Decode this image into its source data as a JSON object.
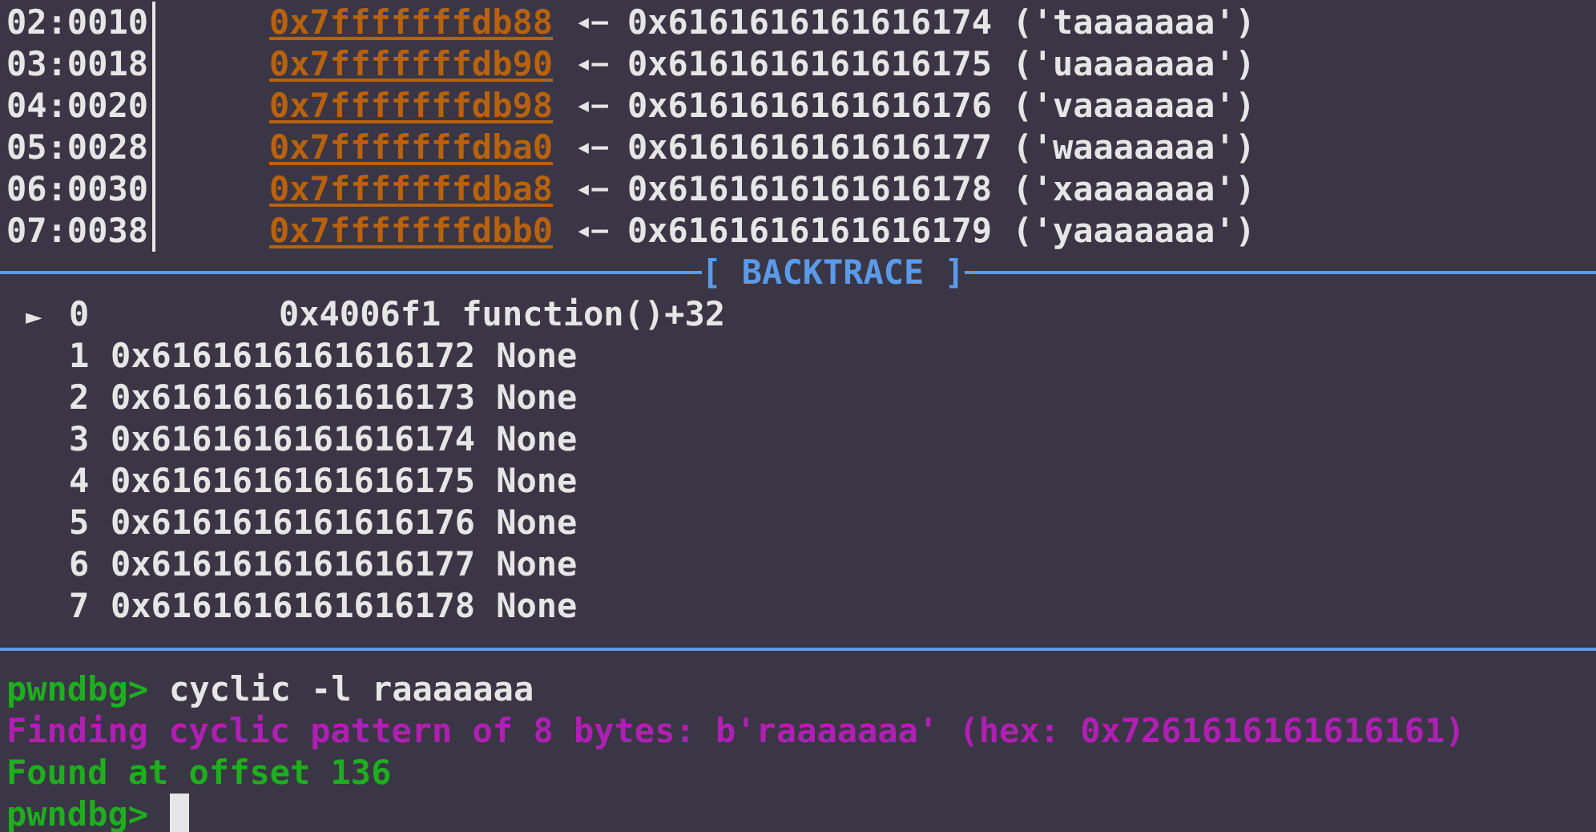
{
  "stack": [
    {
      "offset": "02:0010",
      "address": "0x7fffffffdb88",
      "arrow": "◂—",
      "value": "0x6161616161616174 ('taaaaaaa')"
    },
    {
      "offset": "03:0018",
      "address": "0x7fffffffdb90",
      "arrow": "◂—",
      "value": "0x6161616161616175 ('uaaaaaaa')"
    },
    {
      "offset": "04:0020",
      "address": "0x7fffffffdb98",
      "arrow": "◂—",
      "value": "0x6161616161616176 ('vaaaaaaa')"
    },
    {
      "offset": "05:0028",
      "address": "0x7fffffffdba0",
      "arrow": "◂—",
      "value": "0x6161616161616177 ('waaaaaaa')"
    },
    {
      "offset": "06:0030",
      "address": "0x7fffffffdba8",
      "arrow": "◂—",
      "value": "0x6161616161616178 ('xaaaaaaa')"
    },
    {
      "offset": "07:0038",
      "address": "0x7fffffffdbb0",
      "arrow": "◂—",
      "value": "0x6161616161616179 ('yaaaaaaa')"
    }
  ],
  "backtrace": {
    "title": "[ BACKTRACE ]",
    "marker": "►",
    "frames": [
      {
        "index": "0",
        "address": "0x4006f1",
        "symbol": "function()+32",
        "selected": true
      },
      {
        "index": "1",
        "address": "0x6161616161616172",
        "symbol": "None",
        "selected": false
      },
      {
        "index": "2",
        "address": "0x6161616161616173",
        "symbol": "None",
        "selected": false
      },
      {
        "index": "3",
        "address": "0x6161616161616174",
        "symbol": "None",
        "selected": false
      },
      {
        "index": "4",
        "address": "0x6161616161616175",
        "symbol": "None",
        "selected": false
      },
      {
        "index": "5",
        "address": "0x6161616161616176",
        "symbol": "None",
        "selected": false
      },
      {
        "index": "6",
        "address": "0x6161616161616177",
        "symbol": "None",
        "selected": false
      },
      {
        "index": "7",
        "address": "0x6161616161616178",
        "symbol": "None",
        "selected": false
      }
    ]
  },
  "console": [
    {
      "kind": "command",
      "prompt": "pwndbg>",
      "text": "cyclic -l raaaaaaa"
    },
    {
      "kind": "info",
      "text": "Finding cyclic pattern of 8 bytes: b'raaaaaaa' (hex: 0x7261616161616161)"
    },
    {
      "kind": "success",
      "text": "Found at offset 136"
    },
    {
      "kind": "prompt",
      "prompt": "pwndbg>"
    }
  ]
}
